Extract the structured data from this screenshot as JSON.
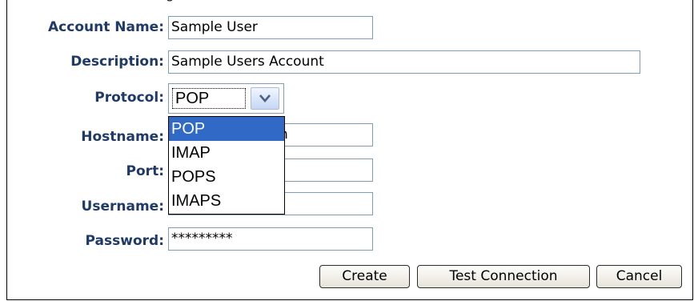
{
  "window": {
    "cutoff_title": "g"
  },
  "form": {
    "account_name": {
      "label": "Account Name:",
      "value": "Sample User"
    },
    "description": {
      "label": "Description:",
      "value": "Sample Users Account"
    },
    "protocol": {
      "label": "Protocol:",
      "selected": "POP",
      "options": [
        "POP",
        "IMAP",
        "POPS",
        "IMAPS"
      ]
    },
    "hostname": {
      "label": "Hostname:",
      "value_visible_fragment": "n"
    },
    "port": {
      "label": "Port:",
      "value": ""
    },
    "username": {
      "label": "Username:",
      "value": ""
    },
    "password": {
      "label": "Password:",
      "value": "*********"
    }
  },
  "buttons": {
    "create": "Create",
    "test_connection": "Test Connection",
    "cancel": "Cancel"
  },
  "colors": {
    "label_text": "#1f3a68",
    "field_border": "#7f9db9",
    "dropdown_highlight": "#3169c6"
  },
  "icons": {
    "select_arrow": "chevron-down-icon"
  }
}
